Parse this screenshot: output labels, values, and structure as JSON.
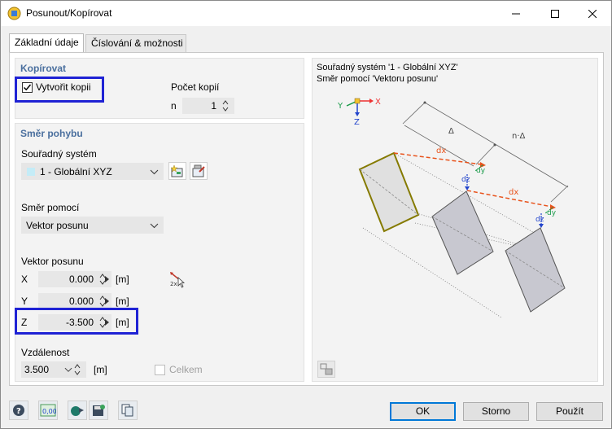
{
  "window": {
    "title": "Posunout/Kopírovat",
    "accent": "#1f22d4",
    "group_title_color": "#4a6f9e"
  },
  "tabs": [
    {
      "label": "Základní údaje",
      "active": true
    },
    {
      "label": "Číslování & možnosti",
      "active": false
    }
  ],
  "copy_group": {
    "title": "Kopírovat",
    "create_copy_label": "Vytvořit kopii",
    "create_copy_checked": true,
    "count_label": "Počet kopií",
    "n_label": "n",
    "n_value": "1"
  },
  "direction_group": {
    "title": "Směr pohybu",
    "coord_system_label": "Souřadný systém",
    "coord_system_value": "1 - Globální XYZ",
    "direction_by_label": "Směr pomocí",
    "direction_by_value": "Vektor posunu",
    "vector_label": "Vektor posunu",
    "vector": [
      {
        "axis": "X",
        "value": "0.000",
        "unit": "[m]"
      },
      {
        "axis": "Y",
        "value": "0.000",
        "unit": "[m]"
      },
      {
        "axis": "Z",
        "value": "-3.500",
        "unit": "[m]"
      }
    ],
    "distance_label": "Vzdálenost",
    "distance_value": "3.500",
    "distance_unit": "[m]",
    "total_label": "Celkem",
    "total_checked": false
  },
  "diagram": {
    "line1": "Souřadný systém '1 - Globální XYZ'",
    "line2": "Směr pomocí 'Vektoru posunu'",
    "axis_x": "X",
    "axis_y": "Y",
    "axis_z": "Z",
    "delta": "Δ",
    "n_delta": "n·Δ",
    "dx": "dx",
    "dy": "dy",
    "dz": "dz"
  },
  "buttons": {
    "ok": "OK",
    "cancel": "Storno",
    "apply": "Použít"
  },
  "footer_icons": [
    "help-icon",
    "units-icon",
    "model-icon",
    "save-icon",
    "copy-settings-icon"
  ]
}
